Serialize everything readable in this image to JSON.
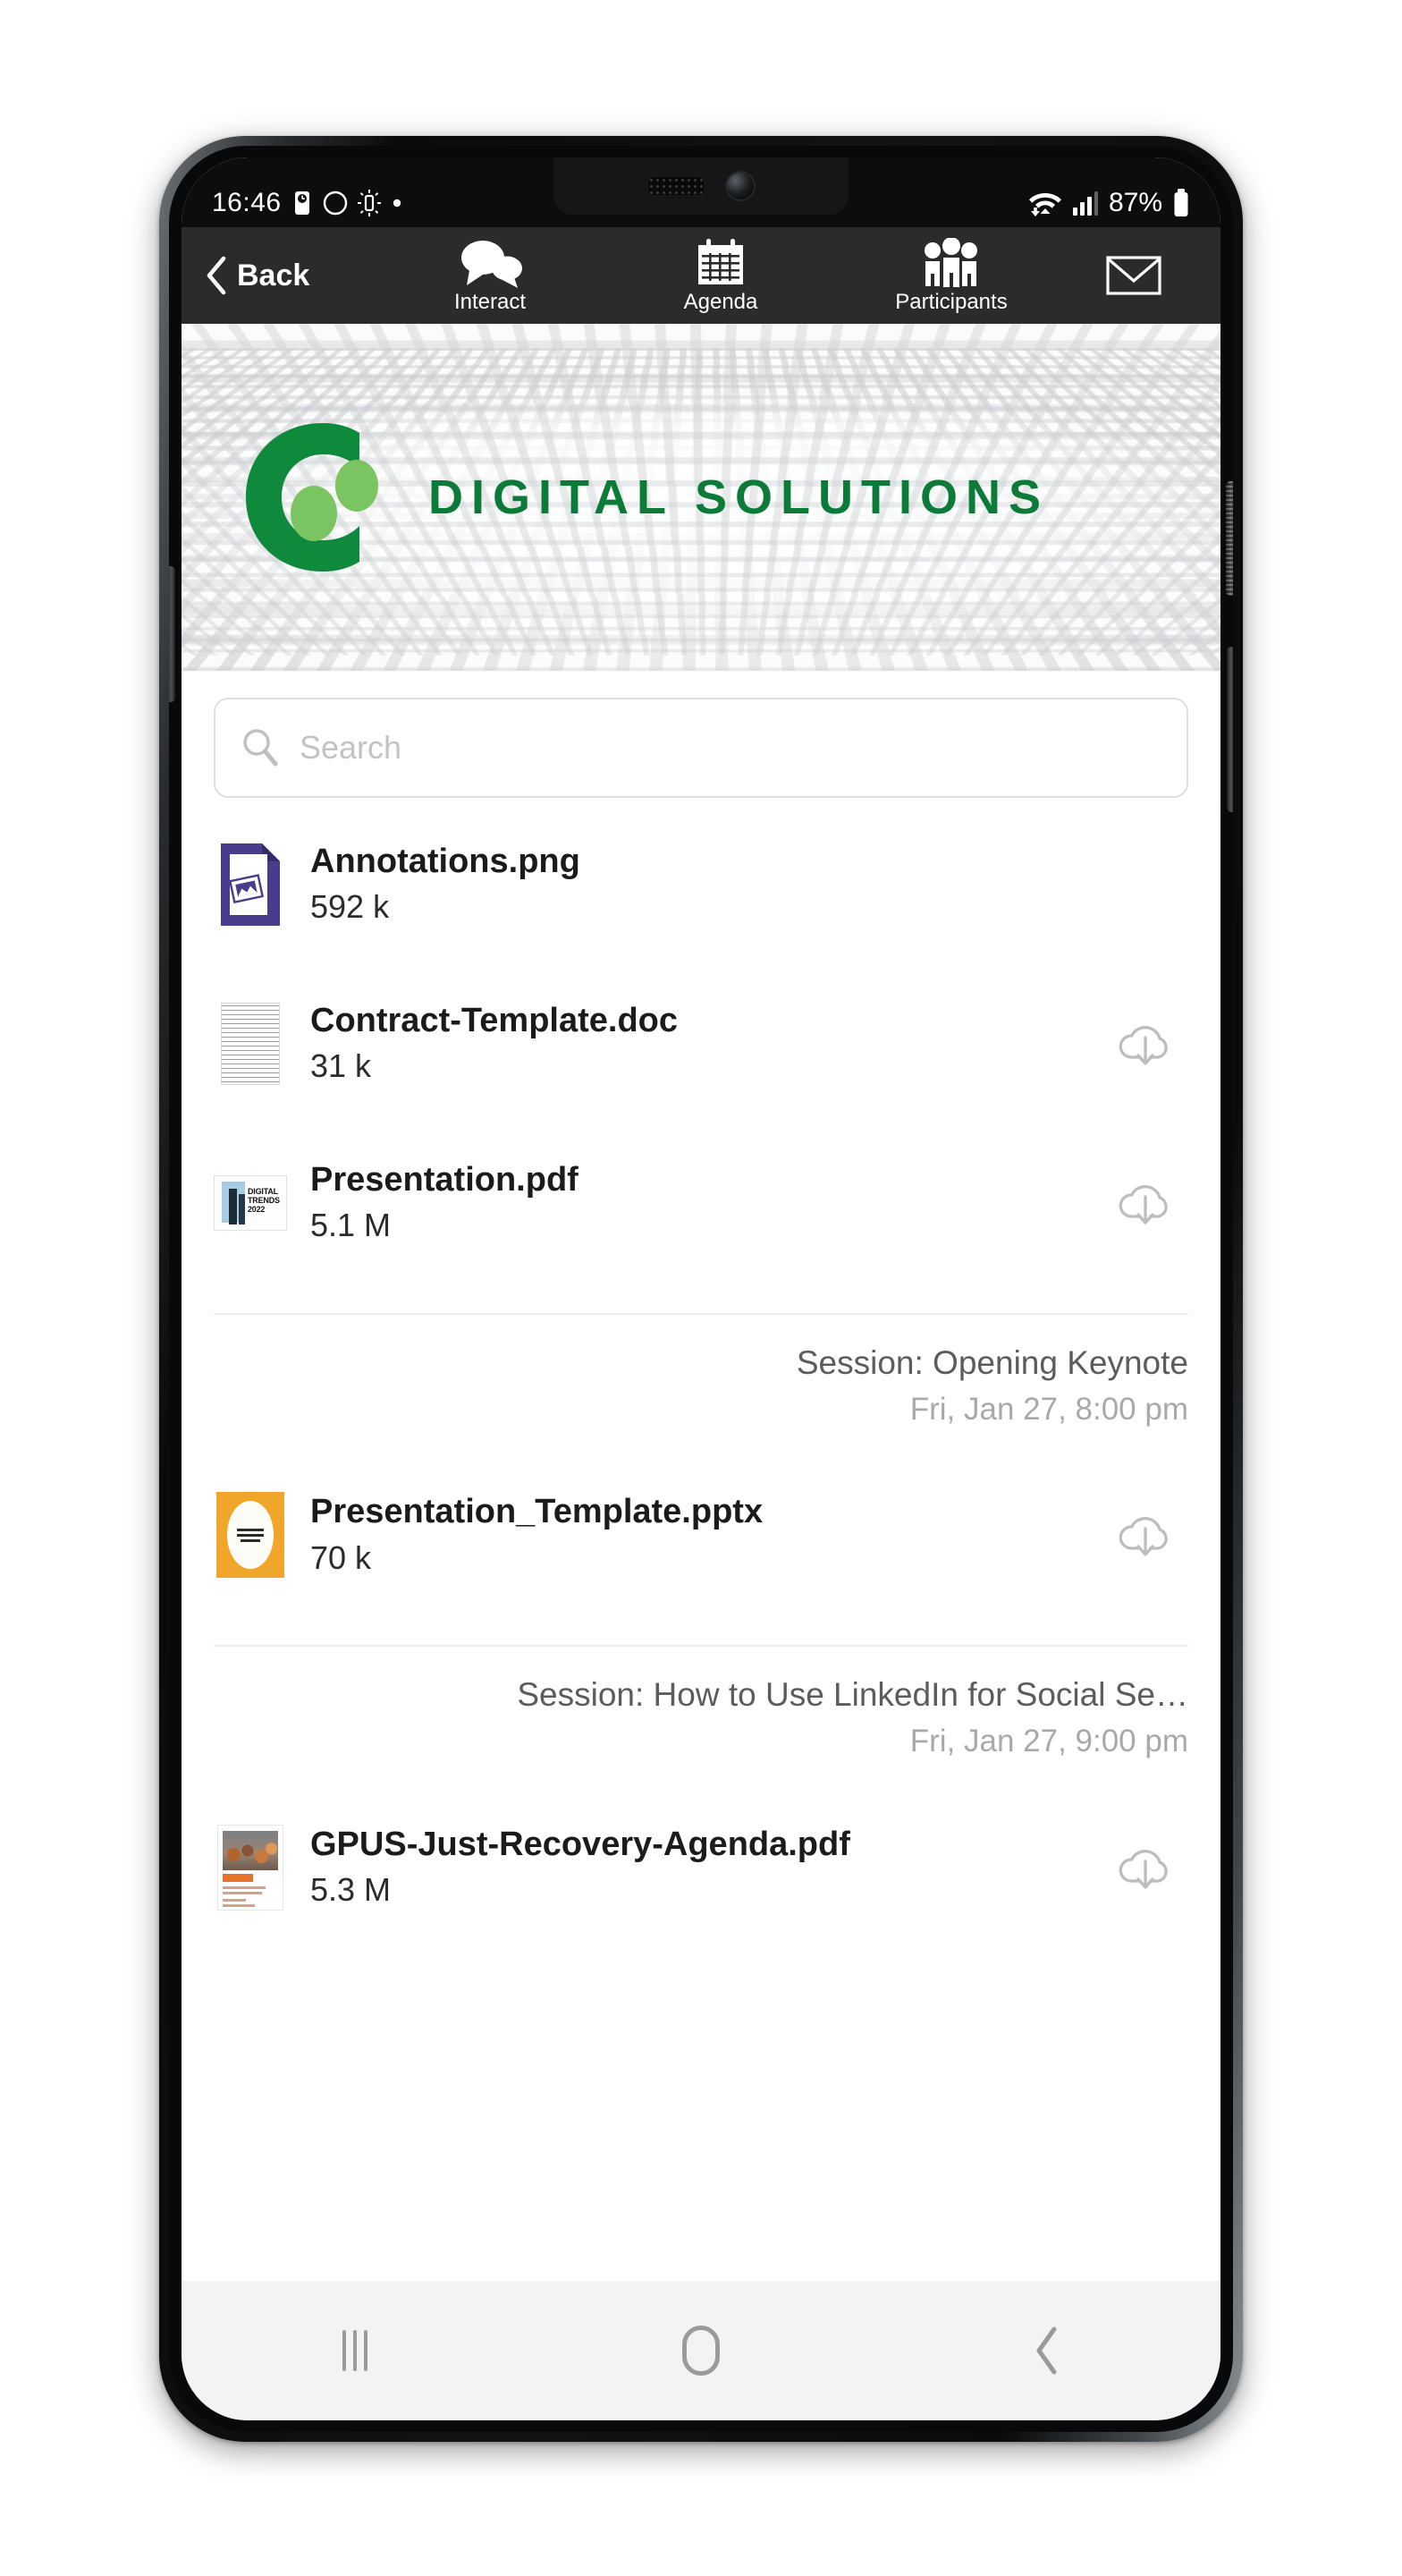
{
  "status_bar": {
    "time": "16:46",
    "battery_percent": "87%",
    "icons": [
      "alarm-icon",
      "do-not-disturb-icon",
      "brightness-icon",
      "dot-icon",
      "wifi-icon",
      "signal-icon",
      "battery-icon"
    ]
  },
  "app_nav": {
    "back_label": "Back",
    "back_icon": "chevron-left-icon",
    "tabs": [
      {
        "label": "Interact",
        "icon": "chat-bubbles-icon"
      },
      {
        "label": "Agenda",
        "icon": "calendar-icon"
      },
      {
        "label": "Participants",
        "icon": "people-icon"
      }
    ],
    "mail_icon": "envelope-icon"
  },
  "banner": {
    "title": "DIGITAL SOLUTIONS",
    "logo_icon": "digital-solutions-logo",
    "brand_green": "#0c7a38",
    "accent_green": "#7bc462"
  },
  "search": {
    "placeholder": "Search",
    "value": "",
    "icon": "search-icon"
  },
  "sections": [
    {
      "header": null,
      "files": [
        {
          "name": "Annotations.png",
          "size": "592 k",
          "thumb": "png-image-file-icon",
          "downloaded": true,
          "download_icon": null
        },
        {
          "name": "Contract-Template.doc",
          "size": "31 k",
          "thumb": "document-page-thumbnail",
          "downloaded": false,
          "download_icon": "cloud-download-icon"
        },
        {
          "name": "Presentation.pdf",
          "size": "5.1 M",
          "thumb": "digital-trends-2022-cover-thumbnail",
          "thumb_text": "DIGITAL TRENDS 2022",
          "downloaded": false,
          "download_icon": "cloud-download-icon"
        }
      ]
    },
    {
      "header": {
        "title": "Session: Opening Keynote",
        "time": "Fri, Jan 27, 8:00 pm"
      },
      "files": [
        {
          "name": "Presentation_Template.pptx",
          "size": "70 k",
          "thumb": "quarterly-business-review-cover-thumbnail",
          "downloaded": false,
          "download_icon": "cloud-download-icon"
        }
      ]
    },
    {
      "header": {
        "title": "Session: How to Use LinkedIn for Social Se…",
        "time": "Fri, Jan 27, 9:00 pm"
      },
      "files": [
        {
          "name": "GPUS-Just-Recovery-Agenda.pdf",
          "size": "5.3 M",
          "thumb": "crowd-photo-report-thumbnail",
          "downloaded": false,
          "download_icon": "cloud-download-icon"
        }
      ]
    }
  ],
  "android_nav": {
    "recents_icon": "recents-icon",
    "home_icon": "home-icon",
    "back_icon": "back-chevron-icon"
  }
}
